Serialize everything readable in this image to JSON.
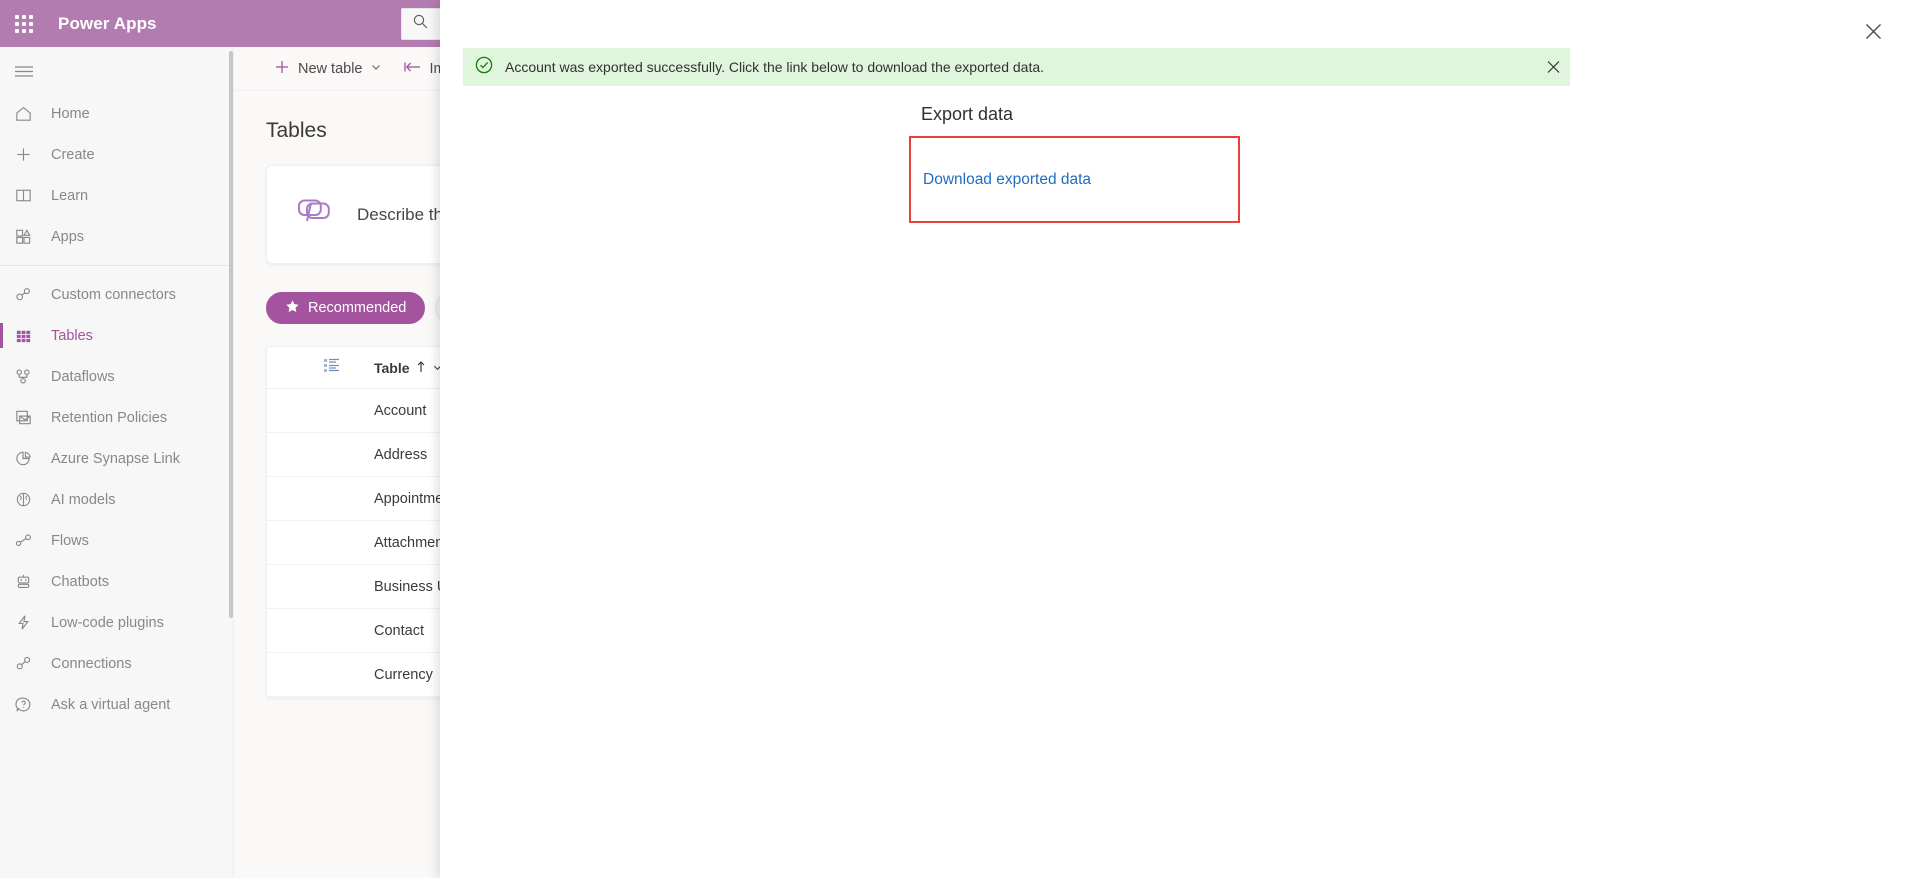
{
  "app": {
    "brand": "Power Apps",
    "waffle_icon": "app-launcher-waffle-icon",
    "brand_bar_color": "#b37cb0"
  },
  "search": {
    "icon": "search-icon",
    "placeholder": "",
    "value": ""
  },
  "sidebar": {
    "menu_icon": "hamburger-menu-icon",
    "scrollbar": "sidebar-scrollbar",
    "primary": [
      {
        "label": "Home",
        "icon": "home-icon",
        "active": false
      },
      {
        "label": "Create",
        "icon": "plus-icon",
        "active": false
      },
      {
        "label": "Learn",
        "icon": "book-icon",
        "active": false
      },
      {
        "label": "Apps",
        "icon": "apps-grid-icon",
        "active": false
      }
    ],
    "secondary": [
      {
        "label": "Custom connectors",
        "icon": "custom-connector-icon",
        "active": false
      },
      {
        "label": "Tables",
        "icon": "tables-grid-icon",
        "active": true
      },
      {
        "label": "Dataflows",
        "icon": "dataflows-icon",
        "active": false
      },
      {
        "label": "Retention Policies",
        "icon": "retention-policies-icon",
        "active": false
      },
      {
        "label": "Azure Synapse Link",
        "icon": "pie-chart-icon",
        "active": false
      },
      {
        "label": "AI models",
        "icon": "brain-icon",
        "active": false
      },
      {
        "label": "Flows",
        "icon": "flows-icon",
        "active": false
      },
      {
        "label": "Chatbots",
        "icon": "robot-icon",
        "active": false
      },
      {
        "label": "Low-code plugins",
        "icon": "lightning-bolt-icon",
        "active": false
      },
      {
        "label": "Connections",
        "icon": "connections-plug-icon",
        "active": false
      },
      {
        "label": "Ask a virtual agent",
        "icon": "question-circle-icon",
        "active": false
      }
    ]
  },
  "commandbar": {
    "new_table": "New table",
    "new_table_icon": "plus-icon",
    "new_table_chevron": "chevron-down-icon",
    "import": "Import",
    "import_icon": "import-arrow-icon"
  },
  "page": {
    "title": "Tables",
    "promo": {
      "icon": "copilot-icon",
      "text": "Describe the"
    }
  },
  "filters": [
    {
      "label": "Recommended",
      "icon": "star-icon",
      "selected": true
    },
    {
      "label": "",
      "icon": "",
      "selected": false
    }
  ],
  "table_grid": {
    "list_icon": "list-view-icon",
    "columns": [
      {
        "label": "Table",
        "sort_icon": "sort-ascending-arrow",
        "chevron": "chevron-down-icon"
      }
    ],
    "rows": [
      {
        "name": "Account"
      },
      {
        "name": "Address"
      },
      {
        "name": "Appointment"
      },
      {
        "name": "Attachment"
      },
      {
        "name": "Business Unit"
      },
      {
        "name": "Contact"
      },
      {
        "name": "Currency"
      }
    ]
  },
  "panel": {
    "close_icon": "close-icon",
    "notification": {
      "icon": "success-check-circle-icon",
      "message": "Account was exported successfully. Click the link below to download the exported data.",
      "dismiss_icon": "close-icon",
      "background": "#dff6dd"
    },
    "heading": "Export data",
    "download_link": "Download exported data",
    "highlight_color": "#e8413c",
    "link_color": "#1f6ec2"
  }
}
